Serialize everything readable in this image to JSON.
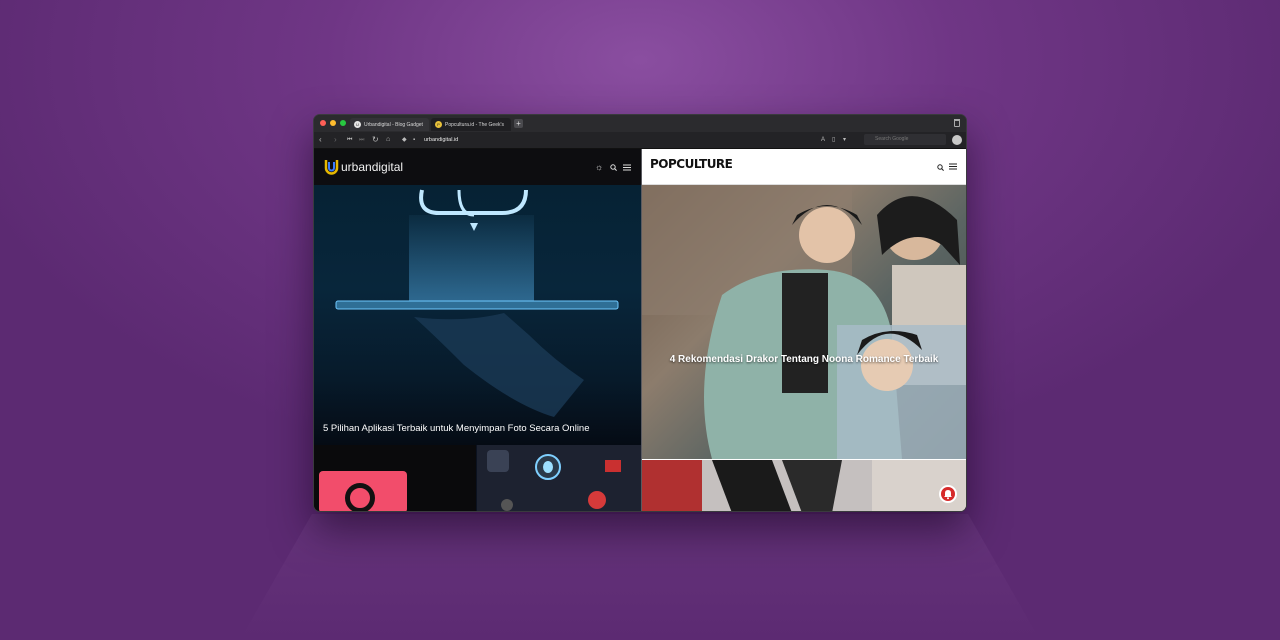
{
  "colors": {
    "background": "#6f3685",
    "window": "#1b1b1d",
    "accent_red": "#d62a2a"
  },
  "browser": {
    "tabs": [
      {
        "label": "Urbandigital - Blog Gadget",
        "favicon": "U",
        "active": false
      },
      {
        "label": "Popcultura.id - The Geek's",
        "favicon": "P",
        "active": true
      }
    ],
    "url": "urbandigital.id",
    "search_placeholder": "Search Google"
  },
  "left_pane": {
    "site_name": "urbandigital",
    "icons": [
      "sun-icon",
      "search-icon",
      "menu-icon"
    ],
    "hero_title": "5 Pilihan Aplikasi Terbaik untuk Menyimpan Foto Secara Online"
  },
  "right_pane": {
    "site_name": "POPCULTURE",
    "icons": [
      "search-icon",
      "menu-icon"
    ],
    "hero_title": "4 Rekomendasi Drakor Tentang Noona Romance Terbaik"
  }
}
